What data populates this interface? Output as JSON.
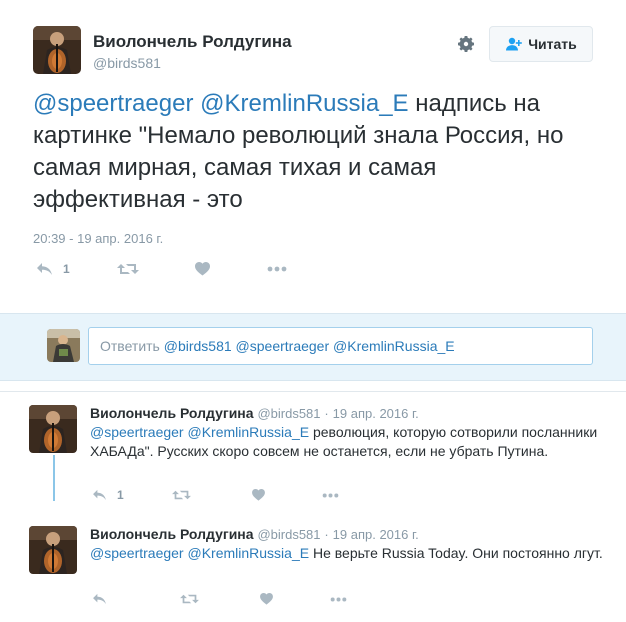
{
  "author": {
    "name": "Виолончель Ролдугина",
    "handle": "@birds581"
  },
  "follow_button": {
    "label": "Читать"
  },
  "main_tweet": {
    "mentions": [
      "@speertraeger",
      "@KremlinRussia_E"
    ],
    "text": "надпись на картинке \"Немало революций знала Россия, но самая мирная, самая тихая и самая эффективная - это",
    "timestamp": "20:39 - 19 апр. 2016 г.",
    "reply_count": "1"
  },
  "reply_composer": {
    "prefix": "Ответить",
    "mentions": "@birds581 @speertraeger @KremlinRussia_E"
  },
  "thread": [
    {
      "name": "Виолончель Ролдугина",
      "handle": "@birds581",
      "separator": "·",
      "date": "19 апр. 2016 г.",
      "mentions": "@speertraeger @KremlinRussia_E",
      "text": "революция, которую сотворили посланники ХАБАДа\". Русских скоро совсем не останется, если не убрать Путина.",
      "reply_count": "1"
    },
    {
      "name": "Виолончель Ролдугина",
      "handle": "@birds581",
      "separator": "·",
      "date": "19 апр. 2016 г.",
      "mentions": "@speertraeger @KremlinRussia_E",
      "text": "Не верьте Russia Today. Они постоянно лгут.",
      "reply_count": ""
    }
  ],
  "colors": {
    "link": "#2b7bb9",
    "muted": "#8899a6",
    "text": "#292f33",
    "composer_bg": "#e8f4fb"
  }
}
